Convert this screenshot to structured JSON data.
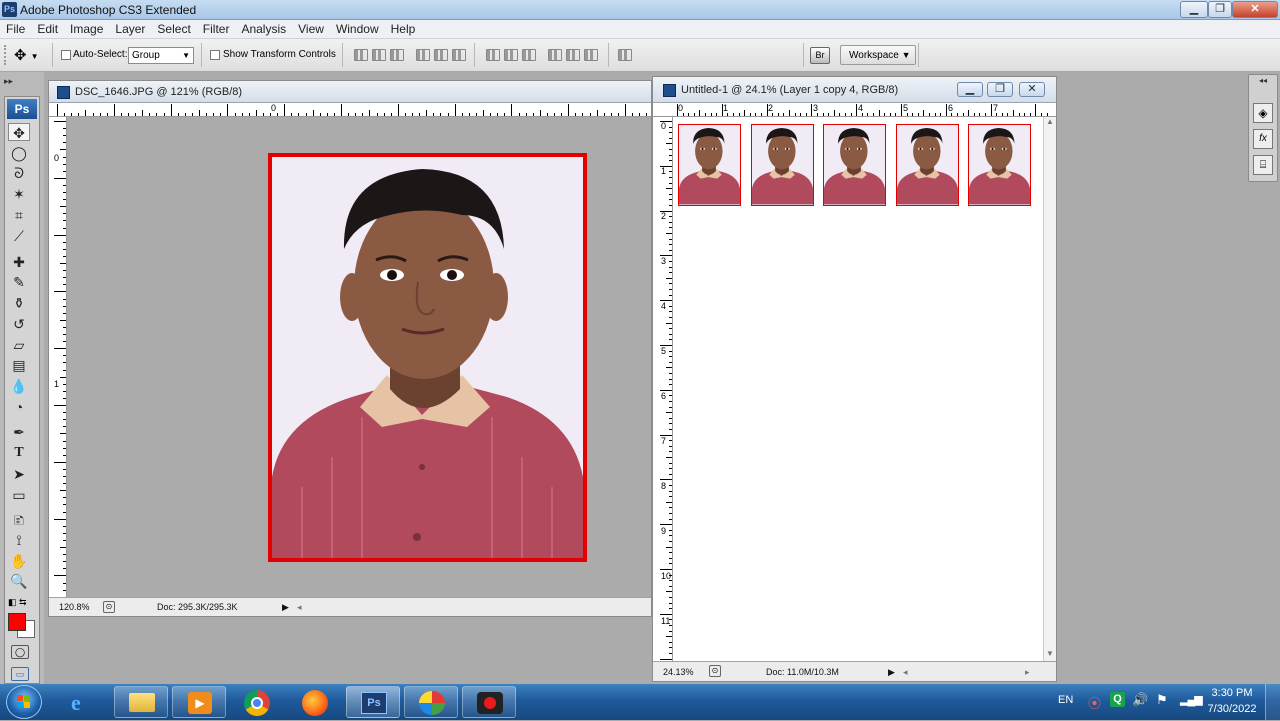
{
  "window": {
    "title": "Adobe Photoshop CS3 Extended",
    "badge": "Ps"
  },
  "menu": [
    "File",
    "Edit",
    "Image",
    "Layer",
    "Select",
    "Filter",
    "Analysis",
    "View",
    "Window",
    "Help"
  ],
  "options": {
    "auto_select_label": "Auto-Select:",
    "auto_select_value": "Group",
    "transform_label": "Show Transform Controls",
    "workspace_label": "Workspace"
  },
  "toolbox": {
    "badge": "Ps",
    "tools": [
      "move",
      "ellipse-marquee",
      "lasso",
      "magic-wand",
      "crop",
      "eyedropper-slice",
      "healing",
      "brush",
      "clone-stamp",
      "history-brush",
      "eraser",
      "gradient",
      "blur",
      "dodge",
      "pen",
      "type",
      "path-select",
      "shape",
      "notes",
      "eyedropper",
      "hand",
      "zoom"
    ],
    "fg_color": "#ff0000",
    "bg_color": "#ffffff"
  },
  "doc1": {
    "title": "DSC_1646.JPG @ 121% (RGB/8)",
    "zoom": "120.8%",
    "doc_size": "Doc: 295.3K/295.3K",
    "ruler_h": [
      "0"
    ],
    "ruler_v": [
      "0",
      "1"
    ],
    "frame_color": "#e20000"
  },
  "doc2": {
    "title": "Untitled-1 @ 24.1% (Layer 1 copy 4, RGB/8)",
    "zoom": "24.13%",
    "doc_size": "Doc: 11.0M/10.3M",
    "ruler_h": [
      "0",
      "1",
      "2",
      "3",
      "4",
      "5",
      "6",
      "7"
    ],
    "ruler_v": [
      "0",
      "1",
      "2",
      "3",
      "4",
      "5",
      "6",
      "7",
      "8",
      "9",
      "10",
      "11"
    ],
    "photo_count": 5
  },
  "taskbar": {
    "apps": [
      "internet-explorer",
      "file-explorer",
      "media-player",
      "chrome",
      "firefox",
      "photoshop",
      "app",
      "screen-recorder"
    ],
    "lang": "EN",
    "time": "3:30 PM",
    "date": "7/30/2022"
  }
}
